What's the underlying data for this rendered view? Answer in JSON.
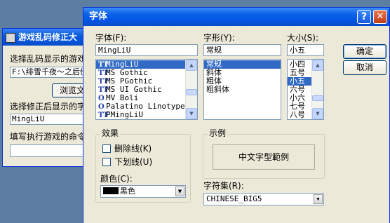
{
  "bg_window": {
    "title": "游戏乱码修正大",
    "label1": "选择乱码显示的游戏",
    "path_value": "F:\\绯雪千夜～之后份",
    "browse_button": "浏览文件",
    "label2": "选择修正后显示的字",
    "font_value": "MingLiU",
    "label3": "填写执行游戏的命令",
    "command_value": ""
  },
  "font_dialog": {
    "title": "字体",
    "help_label": "?",
    "close_label": "✕",
    "font_label": "字体(F):",
    "font_value": "MingLiU",
    "fonts": [
      {
        "icon": "TT",
        "name": "MingLiU",
        "selected": true
      },
      {
        "icon": "TT",
        "name": "MS Gothic"
      },
      {
        "icon": "TT",
        "name": "MS PGothic"
      },
      {
        "icon": "TT",
        "name": "MS UI Gothic"
      },
      {
        "icon": "O",
        "name": "MV Boli"
      },
      {
        "icon": "O",
        "name": "Palatino Linotype"
      },
      {
        "icon": "TT",
        "name": "PMingLiU"
      }
    ],
    "style_label": "字形(Y):",
    "style_value": "常规",
    "styles": [
      {
        "name": "常规",
        "selected": true
      },
      {
        "name": "斜体"
      },
      {
        "name": "粗体"
      },
      {
        "name": "粗斜体"
      }
    ],
    "size_label": "大小(S):",
    "size_value": "小五",
    "sizes": [
      {
        "name": "小四"
      },
      {
        "name": "五号"
      },
      {
        "name": "小五",
        "selected": true
      },
      {
        "name": "六号"
      },
      {
        "name": "小六"
      },
      {
        "name": "七号"
      },
      {
        "name": "八号"
      }
    ],
    "ok_button": "确定",
    "cancel_button": "取消",
    "effects_label": "效果",
    "strikeout_label": "删除线(K)",
    "underline_label": "下划线(U)",
    "color_label": "颜色(C):",
    "color_value": "黑色",
    "color_hex": "#000000",
    "sample_label": "示例",
    "sample_text": "中文字型範例",
    "charset_label": "字符集(R):",
    "charset_value": "CHINESE_BIG5"
  },
  "colors": {
    "titlebar": "#0a5fd8",
    "selection": "#316ac5",
    "dialog_bg": "#ece9d8"
  }
}
